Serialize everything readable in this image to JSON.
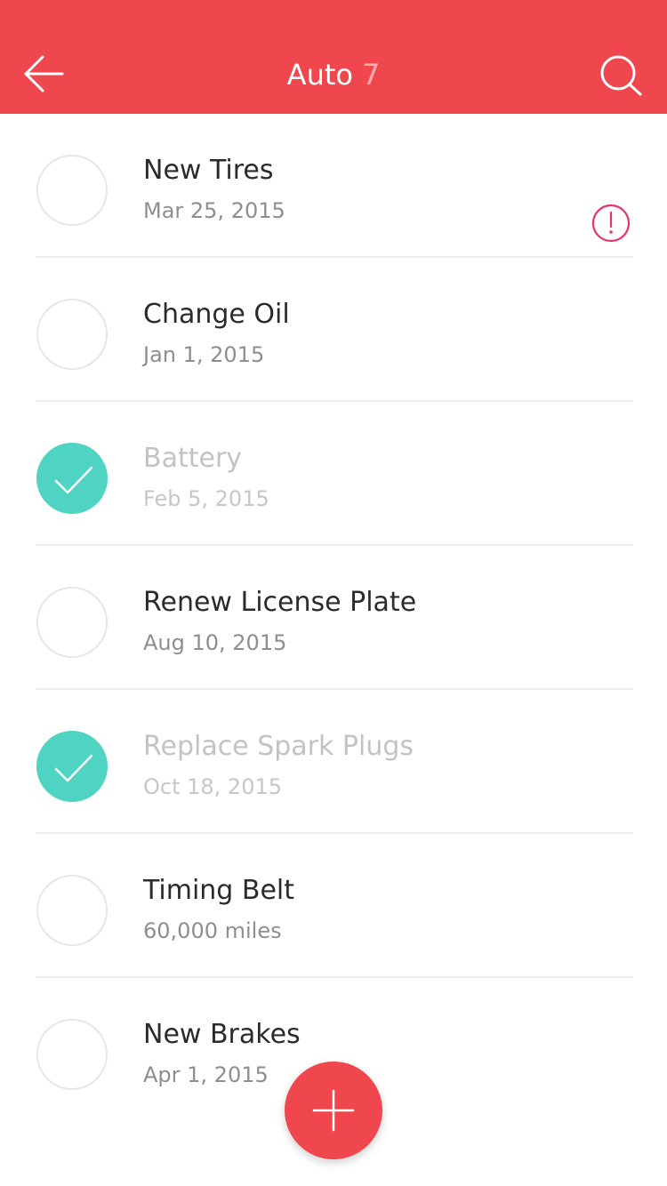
{
  "colors": {
    "accent": "#f0474e",
    "done": "#4fd3c2",
    "alert": "#e8336f"
  },
  "header": {
    "title": "Auto",
    "count": "7",
    "back_icon": "back-arrow-icon",
    "search_icon": "search-icon"
  },
  "items": [
    {
      "title": "New Tires",
      "subtitle": "Mar 25, 2015",
      "completed": false,
      "alert": false
    },
    {
      "title": "Change Oil",
      "subtitle": "Jan 1, 2015",
      "completed": false,
      "alert": true
    },
    {
      "title": "Battery",
      "subtitle": "Feb 5, 2015",
      "completed": true,
      "alert": false
    },
    {
      "title": "Renew License Plate",
      "subtitle": "Aug 10, 2015",
      "completed": false,
      "alert": false
    },
    {
      "title": "Replace Spark Plugs",
      "subtitle": "Oct 18, 2015",
      "completed": true,
      "alert": false
    },
    {
      "title": "Timing Belt",
      "subtitle": "60,000 miles",
      "completed": false,
      "alert": false
    },
    {
      "title": "New Brakes",
      "subtitle": "Apr 1, 2015",
      "completed": false,
      "alert": false
    }
  ],
  "fab": {
    "icon": "plus-icon"
  }
}
